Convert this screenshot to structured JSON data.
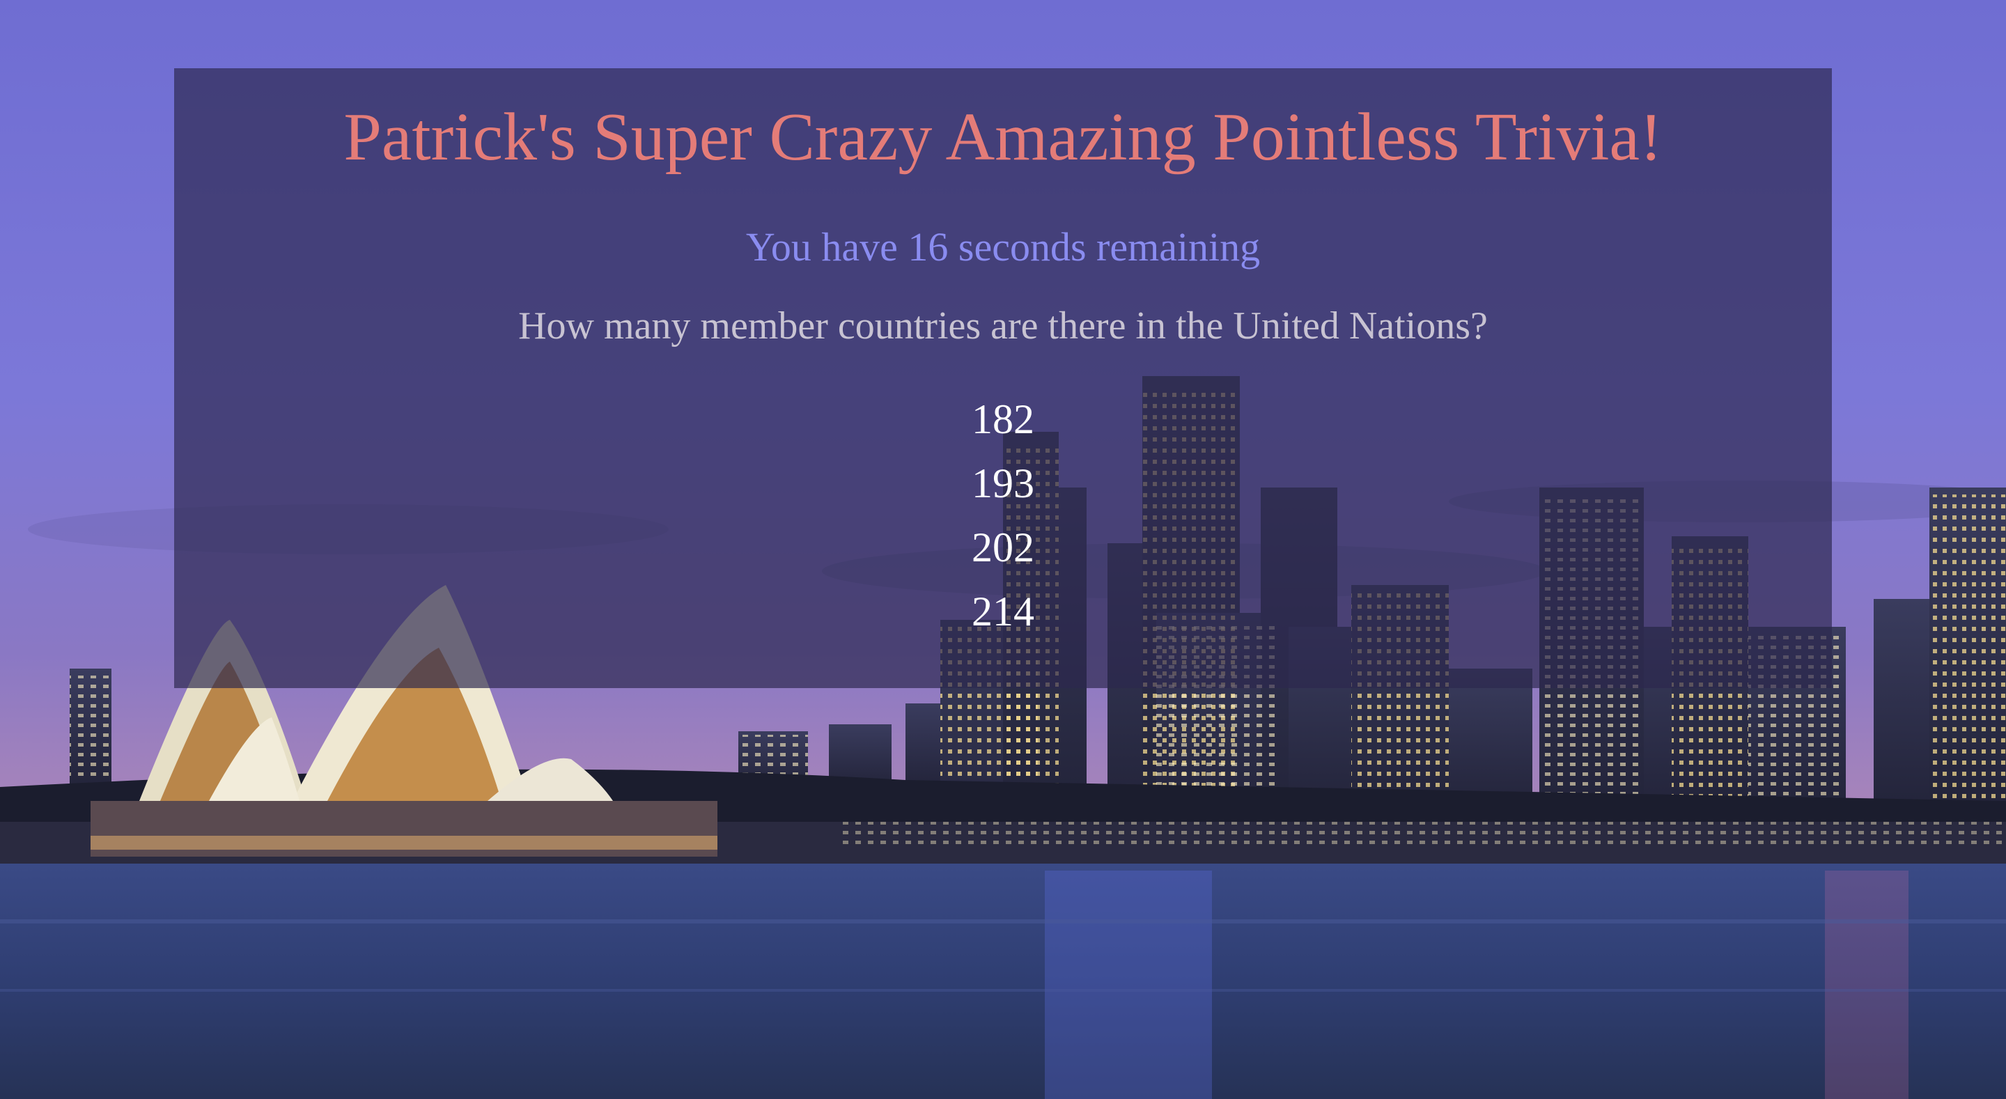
{
  "page": {
    "title": "Patrick's Super Crazy Amazing Pointless Trivia!",
    "timer": {
      "prefix": "You have",
      "seconds": "16",
      "suffix": "seconds remaining"
    },
    "question": "How many member countries are there in the United Nations?",
    "answers": [
      "182",
      "193",
      "202",
      "214"
    ]
  },
  "background": {
    "scene": "Sydney harbour skyline at dusk with opera house",
    "sky_color": "#7a76d2",
    "water_color": "#2f3d6e"
  },
  "colors": {
    "title": "#e47c78",
    "timer": "#8a8cf0",
    "question": "#c8c3d2",
    "answers": "#ffffff",
    "panel": "rgba(44,40,78,0.68)"
  }
}
